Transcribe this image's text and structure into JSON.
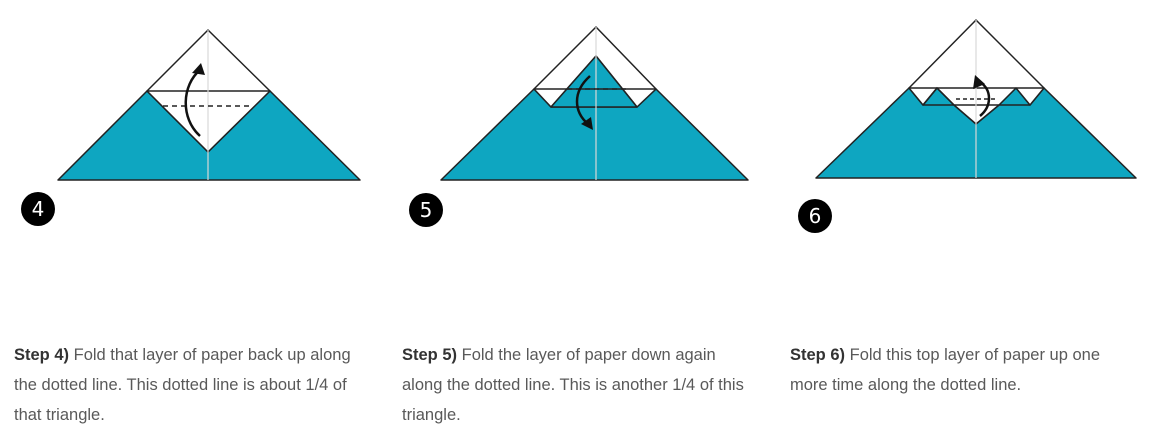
{
  "colors": {
    "paper": "#0ea6c1",
    "outline": "#222222",
    "badge": "#000000"
  },
  "steps": [
    {
      "number": "4",
      "label": "Step 4)",
      "text": "Fold that layer of paper back up along the dotted line. This dotted line is about 1/4 of that triangle."
    },
    {
      "number": "5",
      "label": "Step 5)",
      "text": "Fold the layer of paper down again along the dotted line. This is another 1/4 of this triangle."
    },
    {
      "number": "6",
      "label": "Step 6)",
      "text": "Fold this top layer of paper up one more time along the dotted line."
    }
  ]
}
